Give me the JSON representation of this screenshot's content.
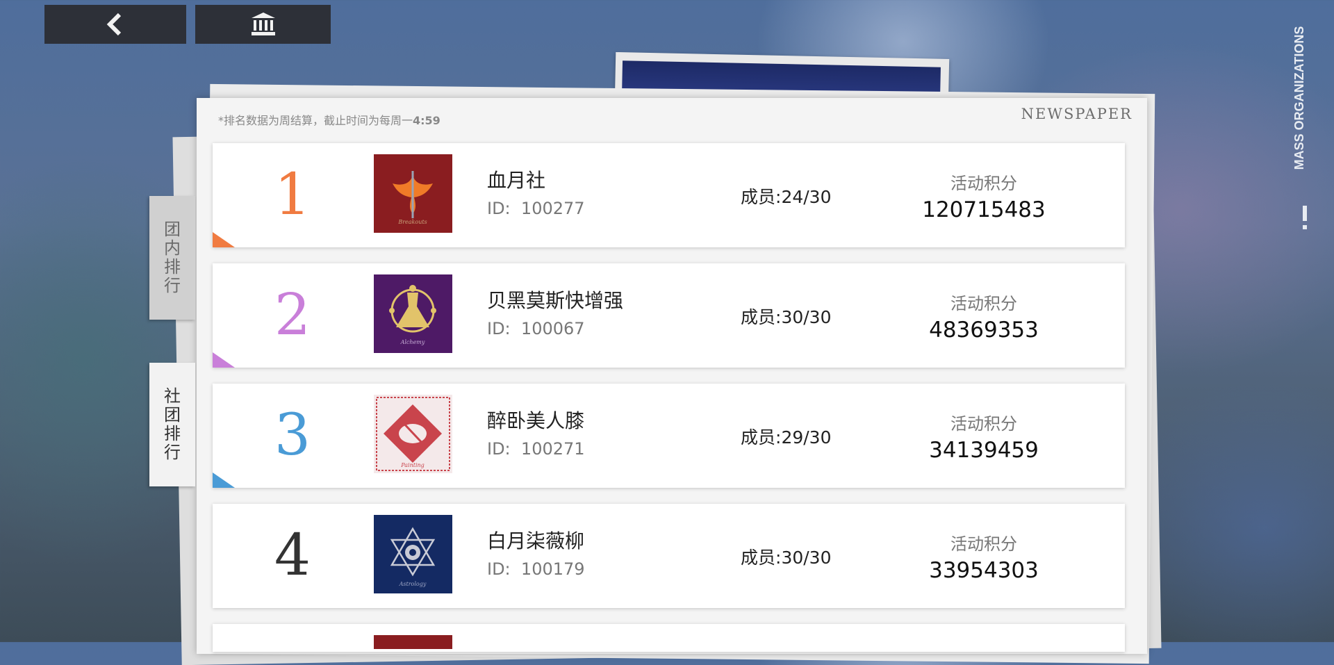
{
  "nav": {
    "back_icon": "chevron-left-icon",
    "home_icon": "bank-icon"
  },
  "side": {
    "title": "MASS ORGANIZATIONS"
  },
  "header": {
    "notice": "*排名数据为周结算，截止时间为每周一",
    "notice_time": "4:59",
    "newspaper": "NEWSPAPER"
  },
  "tabs": [
    {
      "label": "团内排行",
      "active": false
    },
    {
      "label": "社团排行",
      "active": true
    }
  ],
  "rows": [
    {
      "rank": "1",
      "rank_color": "#f07b41",
      "name": "血月社",
      "id_label": "ID:",
      "id": "100277",
      "members_label": "成员:",
      "members": "24/30",
      "score_label": "活动积分",
      "score": "120715483",
      "emblem_color": "#8a1d20",
      "emblem_text": "Breakouts"
    },
    {
      "rank": "2",
      "rank_color": "#c97fd9",
      "name": "贝黑莫斯快增强",
      "id_label": "ID:",
      "id": "100067",
      "members_label": "成员:",
      "members": "30/30",
      "score_label": "活动积分",
      "score": "48369353",
      "emblem_color": "#4e1a66",
      "emblem_text": "Alchemy"
    },
    {
      "rank": "3",
      "rank_color": "#4a9bd6",
      "name": "醉卧美人膝",
      "id_label": "ID:",
      "id": "100271",
      "members_label": "成员:",
      "members": "29/30",
      "score_label": "活动积分",
      "score": "34139459",
      "emblem_color": "#f4e9ea",
      "emblem_text": "Painting"
    },
    {
      "rank": "4",
      "rank_color": "#333333",
      "name": "白月柒薇柳",
      "id_label": "ID:",
      "id": "100179",
      "members_label": "成员:",
      "members": "30/30",
      "score_label": "活动积分",
      "score": "33954303",
      "emblem_color": "#142a63",
      "emblem_text": "Astrology"
    }
  ]
}
